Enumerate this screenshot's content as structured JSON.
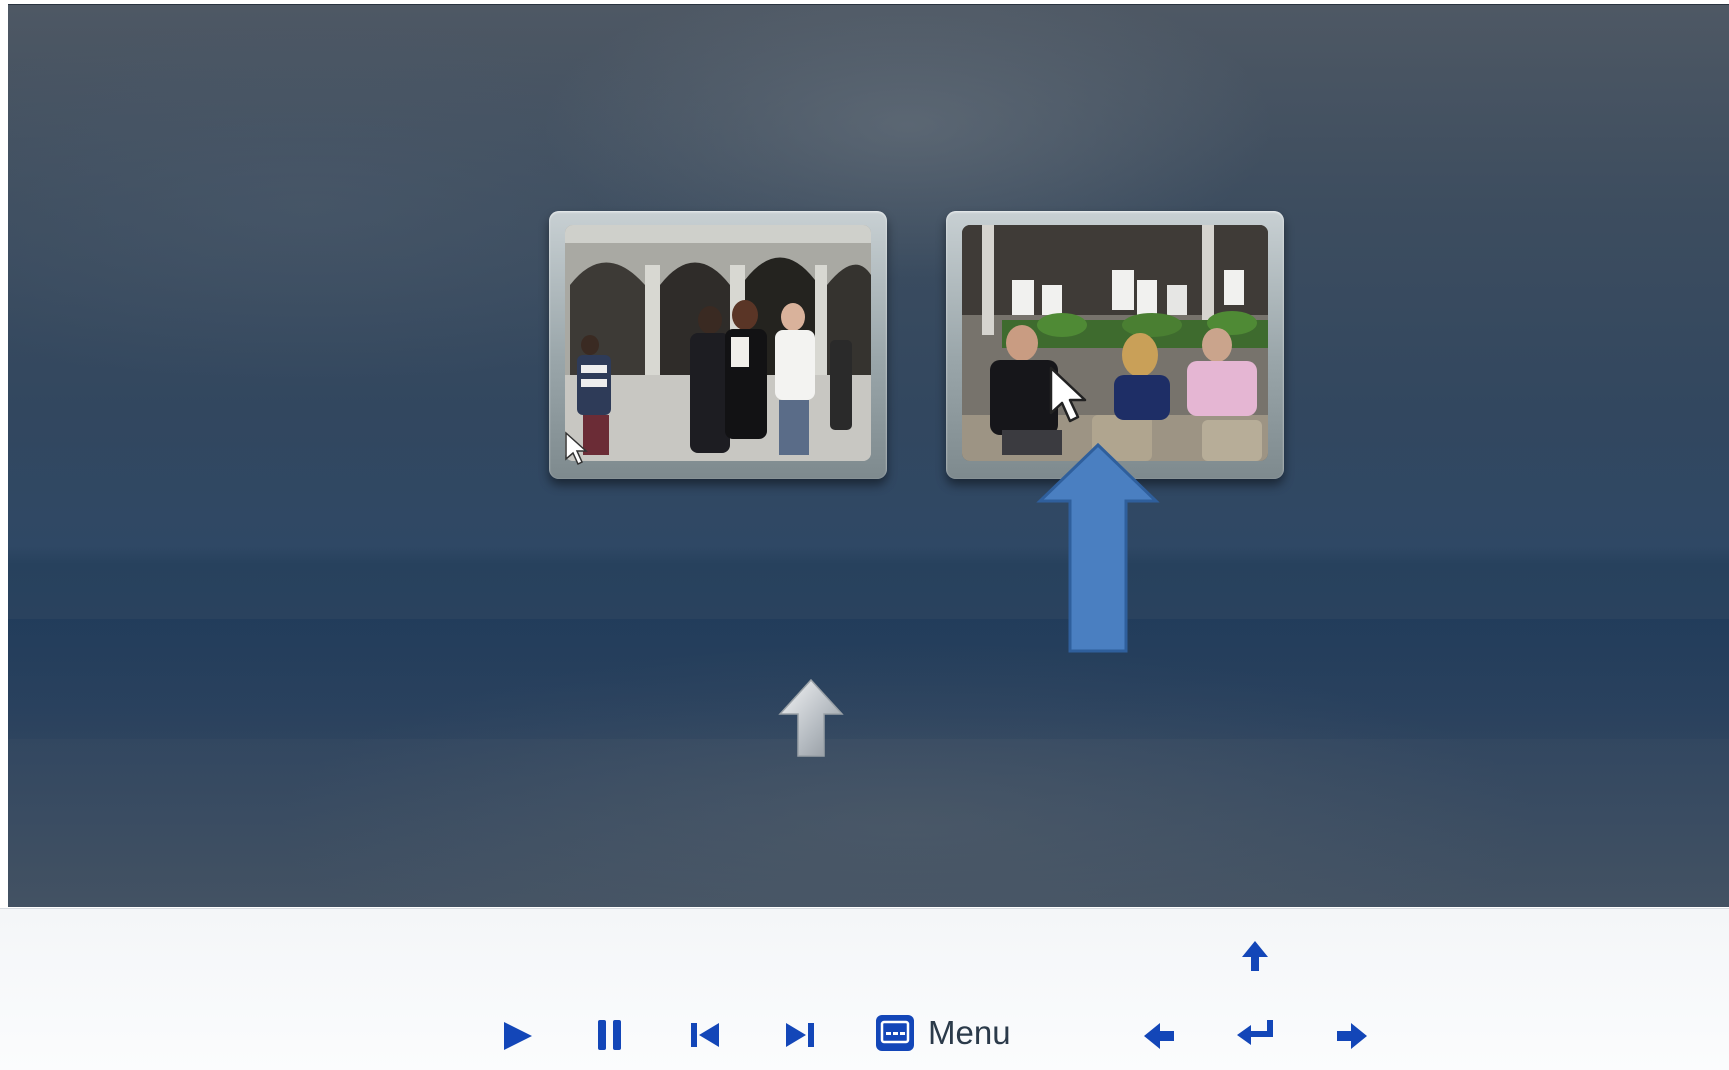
{
  "menu_label": "Menu",
  "colors": {
    "control_blue": "#1346b8",
    "annotation_arrow": "#4a7fc1",
    "annotation_arrow_border": "#2f5f9c"
  },
  "thumbnails": [
    {
      "name": "thumbnail-dancers"
    },
    {
      "name": "thumbnail-cafe"
    }
  ],
  "controls": [
    {
      "name": "play-icon"
    },
    {
      "name": "pause-icon"
    },
    {
      "name": "previous-chapter-icon"
    },
    {
      "name": "next-chapter-icon"
    },
    {
      "name": "menu-icon"
    },
    {
      "name": "arrow-up-icon"
    },
    {
      "name": "arrow-left-icon"
    },
    {
      "name": "enter-icon"
    },
    {
      "name": "arrow-right-icon"
    }
  ]
}
